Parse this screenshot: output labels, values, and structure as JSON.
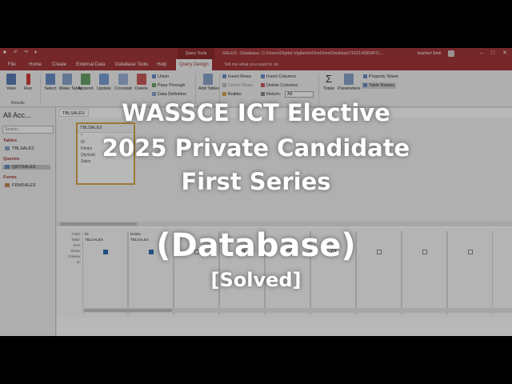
{
  "titlebar": {
    "context_tab": "Query Tools",
    "title": "SALES : Database- C:\\Users\\Digital Vigilante\\OneDrive\\Desktop\\7102143958FO...",
    "user": "teacher! Emil",
    "win_buttons": [
      "–",
      "□",
      "✕"
    ]
  },
  "tabs": [
    "File",
    "Home",
    "Create",
    "External Data",
    "Database Tools",
    "Help",
    "Query Design"
  ],
  "tellme": "Tell me what you want to do",
  "ribbon": {
    "buttons": [
      "View",
      "Run",
      "Select",
      "Make Table",
      "Append",
      "Update",
      "Crosstab",
      "Delete"
    ],
    "query_type_small": [
      "Union",
      "Pass-Through",
      "Data Definition"
    ],
    "add_tables": "Add Tables",
    "setup_small": [
      "Insert Rows",
      "Delete Rows",
      "Builder"
    ],
    "setup_small2": [
      "Insert Columns",
      "Delete Columns",
      "Return:"
    ],
    "return_value": "All",
    "totals": "Totals",
    "parameters": "Parameters",
    "showhide": [
      "Property Sheet",
      "Table Names"
    ],
    "group_results": "Results"
  },
  "nav": {
    "title": "All Acc...",
    "search_placeholder": "Search...",
    "tables_header": "Tables",
    "tables": [
      "TBLSALES"
    ],
    "queries_header": "Queries",
    "queries": [
      "QRYSALES"
    ],
    "forms_header": "Forms",
    "forms": [
      "FRMSALES"
    ]
  },
  "doc": {
    "tab": "TBLSALES",
    "table_box": {
      "title": "TBLSALES",
      "fields": [
        "*",
        "ID",
        "Drinks",
        "QtySold",
        "Sales"
      ]
    },
    "grid_labels": [
      "Field:",
      "Table:",
      "Sort:",
      "Show:",
      "Criteria:",
      "or:"
    ],
    "grid_columns": [
      {
        "field": "ID",
        "table": "TBLSALES",
        "show": true
      },
      {
        "field": "Drinks",
        "table": "TBLSALES",
        "show": true
      }
    ]
  },
  "overlay": {
    "line1": "WASSCE ICT Elective",
    "line2": "2025 Private Candidate",
    "line3": "First Series",
    "line4": "(Database)",
    "line5": "[Solved]"
  }
}
